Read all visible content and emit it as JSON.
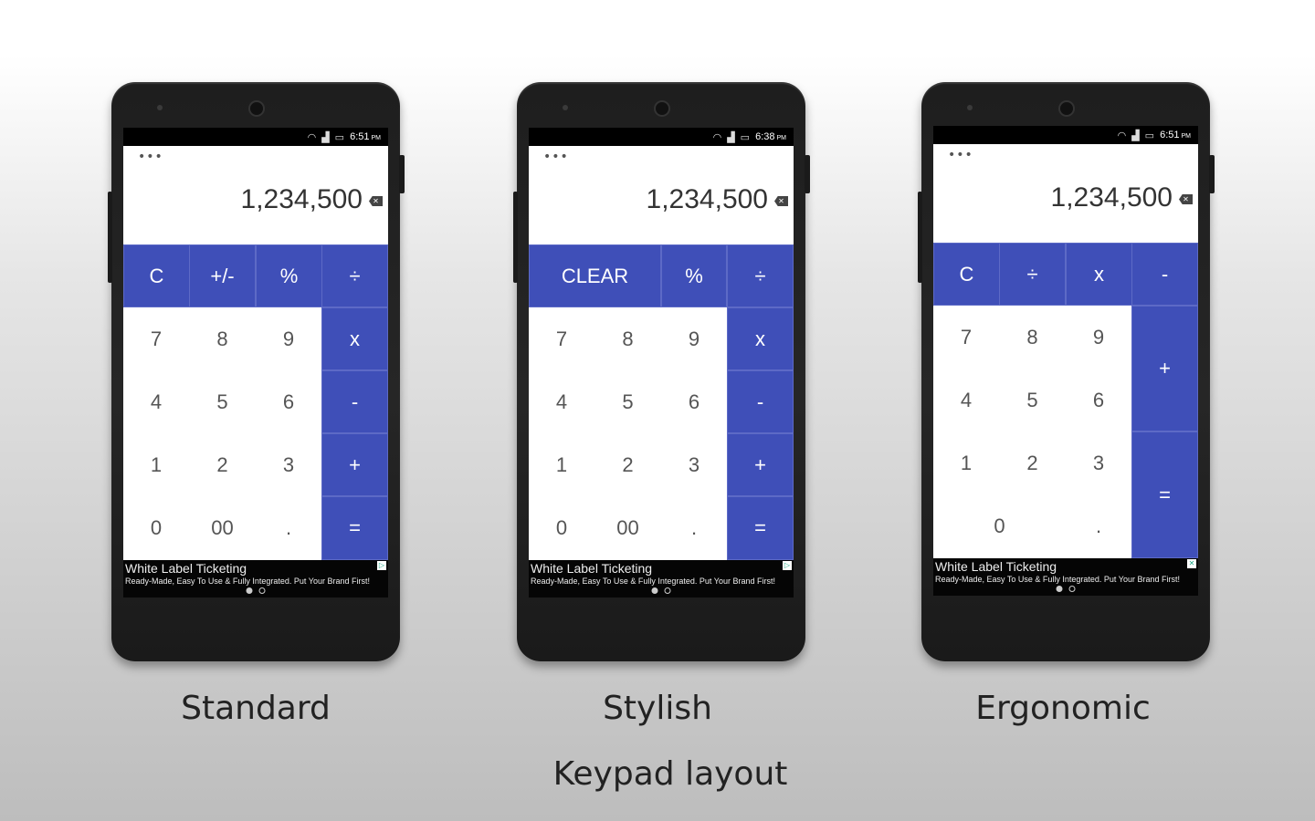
{
  "heading": "Keypad layout",
  "ad": {
    "title": "White Label Ticketing",
    "subtitle": "Ready-Made, Easy To Use & Fully Integrated. Put Your Brand First!"
  },
  "phones": [
    {
      "caption": "Standard",
      "time": "6:51",
      "ampm": "PM",
      "display": "1,234,500",
      "menu": "•••"
    },
    {
      "caption": "Stylish",
      "time": "6:38",
      "ampm": "PM",
      "display": "1,234,500",
      "menu": "•••"
    },
    {
      "caption": "Ergonomic",
      "time": "6:51",
      "ampm": "PM",
      "display": "1,234,500",
      "menu": "•••"
    }
  ],
  "keys": {
    "standard": [
      "C",
      "+/-",
      "%",
      "÷",
      "7",
      "8",
      "9",
      "x",
      "4",
      "5",
      "6",
      "-",
      "1",
      "2",
      "3",
      "+",
      "0",
      "00",
      ".",
      "="
    ],
    "stylish": [
      "CLEAR",
      "%",
      "÷",
      "7",
      "8",
      "9",
      "x",
      "4",
      "5",
      "6",
      "-",
      "1",
      "2",
      "3",
      "+",
      "0",
      "00",
      ".",
      "="
    ],
    "ergonomic": [
      "C",
      "÷",
      "x",
      "-",
      "7",
      "8",
      "9",
      "+",
      "4",
      "5",
      "6",
      "1",
      "2",
      "3",
      "=",
      "0",
      "."
    ]
  },
  "colors": {
    "accent": "#3f4fb8"
  },
  "icons": [
    "wifi-icon",
    "signal-icon",
    "battery-icon",
    "backspace-icon",
    "adchoices-icon"
  ]
}
